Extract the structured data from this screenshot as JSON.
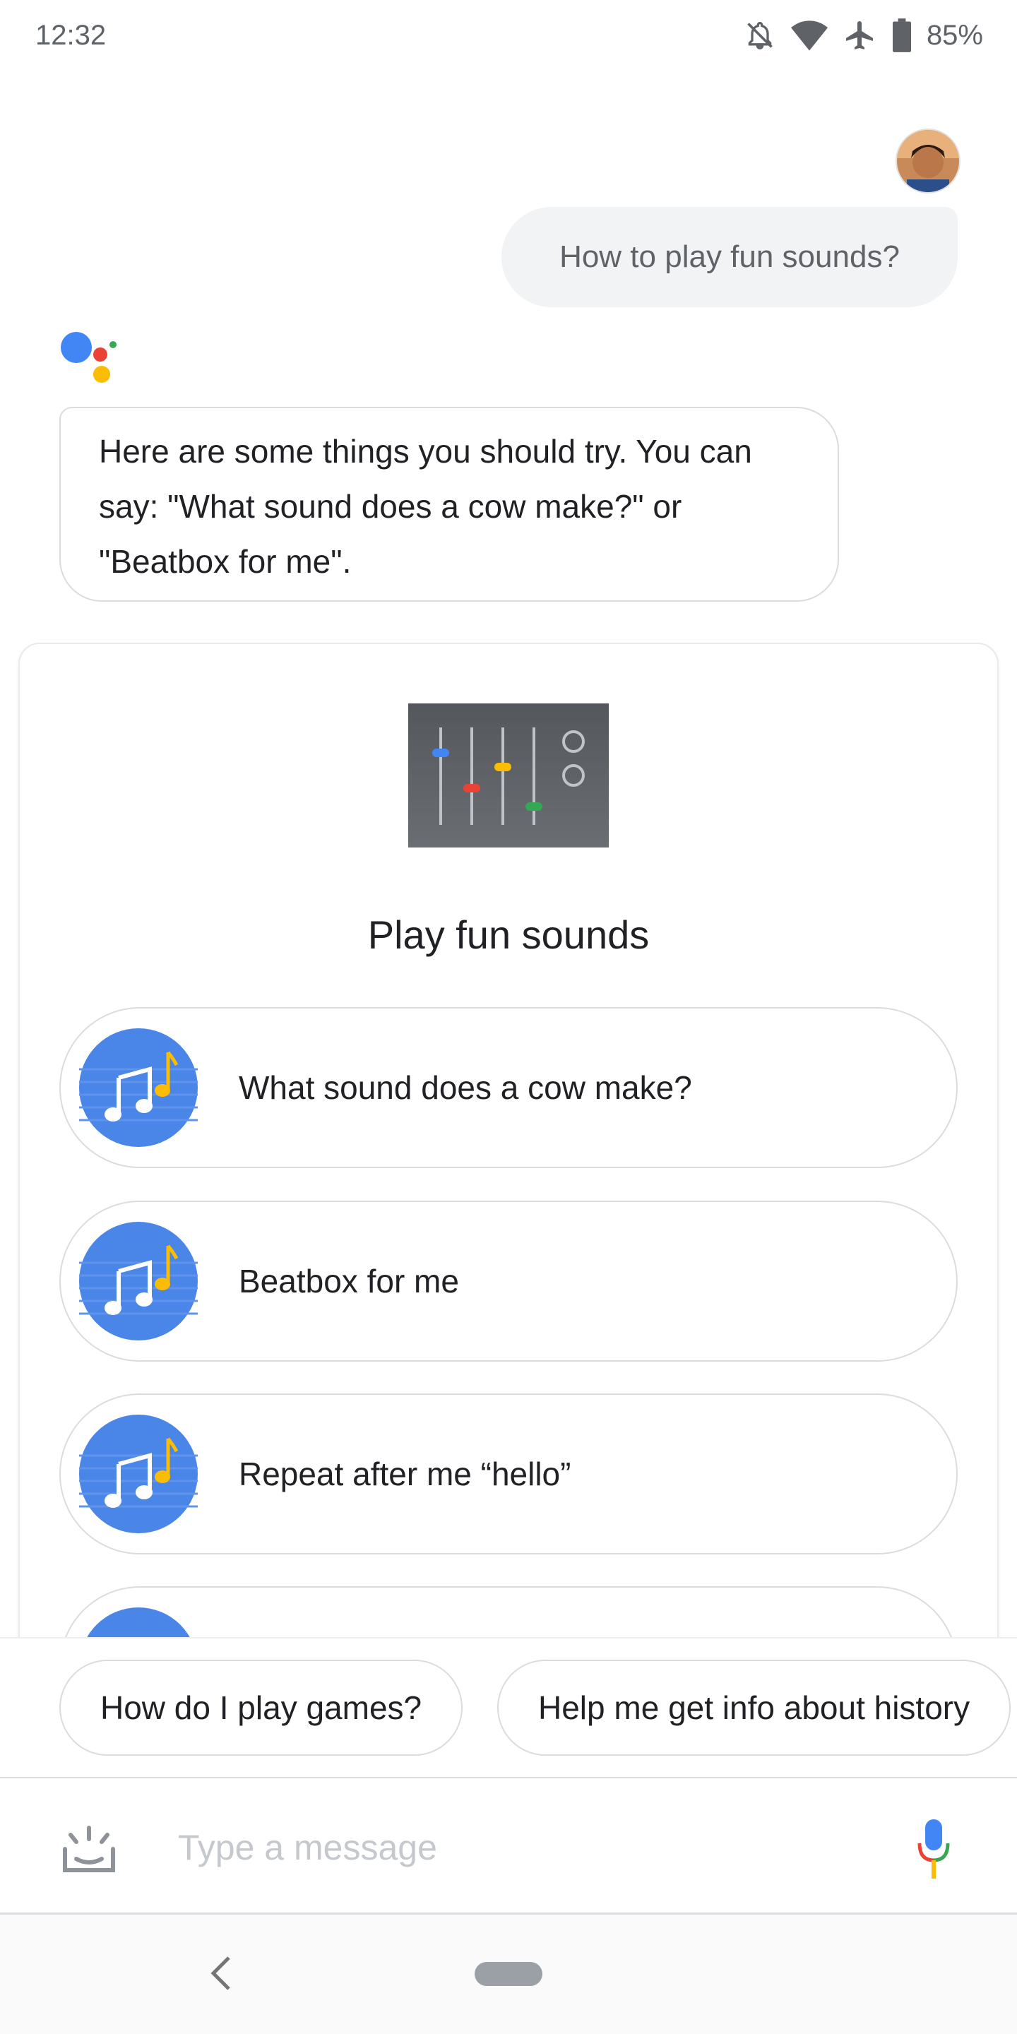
{
  "status_bar": {
    "time": "12:32",
    "battery_percent": "85%",
    "icons": [
      "notifications-off-icon",
      "wifi-icon",
      "airplane-mode-icon",
      "battery-icon"
    ]
  },
  "conversation": {
    "user_message": "How to play fun sounds?",
    "assistant_message": "Here are some things you should try. You can say: \"What sound does a cow make?\" or \"Beatbox for me\"."
  },
  "card": {
    "title": "Play fun sounds",
    "suggestions": [
      {
        "label": "What sound does a cow make?",
        "icon": "music-note-icon"
      },
      {
        "label": "Beatbox for me",
        "icon": "music-note-icon"
      },
      {
        "label": "Repeat after me “hello”",
        "icon": "music-note-icon"
      }
    ]
  },
  "chips": [
    {
      "label": "How do I play games?"
    },
    {
      "label": "Help me get info about history"
    }
  ],
  "input": {
    "placeholder": "Type a message"
  },
  "colors": {
    "google_blue": "#4285f4",
    "google_red": "#ea4335",
    "google_yellow": "#fbbc05",
    "google_green": "#34a853",
    "bubble_grey": "#f1f3f4"
  }
}
